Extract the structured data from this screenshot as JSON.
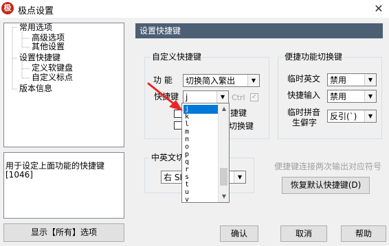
{
  "window": {
    "title": "极点设置",
    "app_icon_text": "极",
    "close_glyph": "✕"
  },
  "tree": {
    "items": [
      "常用选项",
      "高级选项",
      "其他设置",
      "设置快捷键",
      "定义软键盘",
      "自定义标点",
      "版本信息"
    ]
  },
  "description": {
    "line1": "用于设定上面功能的快捷键",
    "line2": "[1046]"
  },
  "buttons": {
    "show_all": "显示【所有】选项",
    "ok": "确认",
    "cancel": "取消",
    "help": "帮助",
    "restore_default": "恢复默认快捷键(D)"
  },
  "content": {
    "header": "设置快捷键",
    "custom_group": {
      "title": "自定义快捷键",
      "function_label": "功  能",
      "function_value": "切换简入繁出",
      "shortcut_label": "快捷键",
      "shortcut_value": "j",
      "ctrl_label": "Ctrl",
      "ctrl_checked_glyph": "✓",
      "option1_tail": "捷键",
      "option2_tail": "切换键"
    },
    "convenience_group": {
      "title": "便捷功能切换键",
      "temp_english_label": "临时英文",
      "temp_english_value": "禁用",
      "quick_input_label": "快捷输入",
      "quick_input_value": "禁用",
      "temp_pinyin_label1": "临时拼音",
      "temp_pinyin_label2": "生僻字",
      "temp_pinyin_value": "反引(`)"
    },
    "zhen_group": {
      "title": "中英文切",
      "value": "右 SI"
    },
    "hint": "便捷键连接两次输出对应符号",
    "dropdown_items": [
      "j",
      "k",
      "l",
      "m",
      "n",
      "o",
      "p",
      "q",
      "r",
      "s",
      "t",
      "u",
      "v"
    ],
    "dropdown_selected": "j"
  },
  "colors": {
    "header_bg": "#4c5f74",
    "selection": "#0078d7",
    "arrow": "#e8272a"
  }
}
